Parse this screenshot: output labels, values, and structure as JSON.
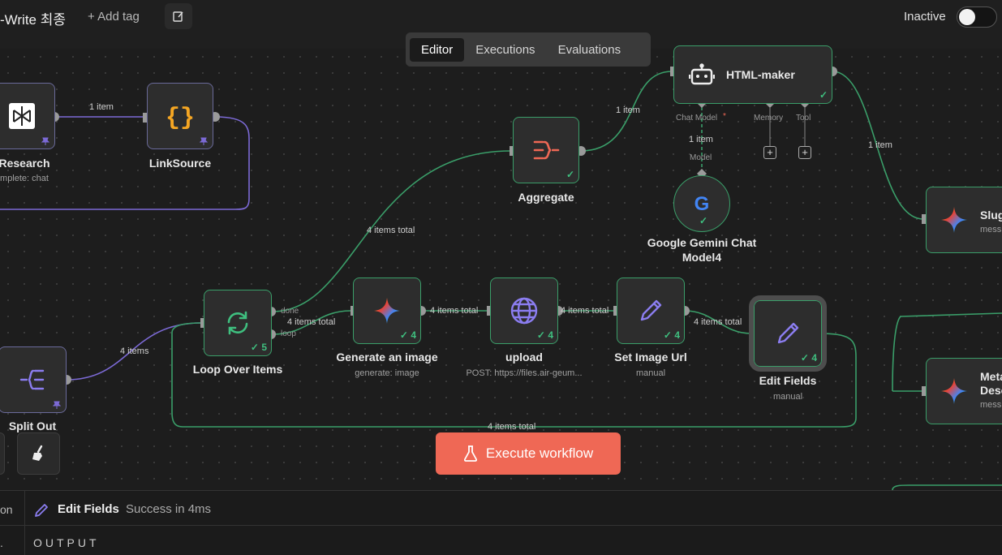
{
  "header": {
    "workflow_title": "-Write 최종",
    "add_tag": "+ Add tag",
    "status_label": "Inactive"
  },
  "tabs": [
    {
      "label": "Editor",
      "active": true
    },
    {
      "label": "Executions",
      "active": false
    },
    {
      "label": "Evaluations",
      "active": false
    }
  ],
  "nodes": {
    "research": {
      "label": "Research",
      "sub": "mplete: chat"
    },
    "linksource": {
      "label": "LinkSource"
    },
    "aggregate": {
      "label": "Aggregate"
    },
    "html_maker": {
      "label": "HTML-maker",
      "ports": [
        "Chat Model",
        "*",
        "Memory",
        "Tool"
      ]
    },
    "gemini": {
      "label_line1": "Google Gemini Chat",
      "label_line2": "Model4"
    },
    "slug": {
      "label": "Slug",
      "sub": "mess"
    },
    "meta": {
      "label_line1": "Meta",
      "label_line2": "Desc",
      "sub": "mess"
    },
    "loop": {
      "label": "Loop Over Items",
      "count": "5",
      "port_done": "done",
      "port_loop": "loop"
    },
    "generate": {
      "label": "Generate an image",
      "sub": "generate: image",
      "count": "4"
    },
    "upload": {
      "label": "upload",
      "sub": "POST: https://files.air-geum...",
      "count": "4"
    },
    "set_image": {
      "label": "Set Image Url",
      "sub": "manual",
      "count": "4"
    },
    "edit_fields": {
      "label": "Edit Fields",
      "sub": "manual",
      "count": "4"
    },
    "split_out": {
      "label": "Split Out"
    }
  },
  "wire_labels": {
    "research_link": "1 item",
    "agg_html": "1 item",
    "html_slug": "1 item",
    "gemini_html": "1 item",
    "gemini_port": "Model",
    "loop_agg": "4 items total",
    "loop_gen": "4 items total",
    "gen_upload": "4 items total",
    "upload_set": "4 items total",
    "set_edit": "4 items total",
    "split_loop": "4 items",
    "feedback": "4 items total"
  },
  "execute_button": "Execute workflow",
  "bottom_panel": {
    "cut_left_1": "on",
    "cut_left_2": ".",
    "node_name": "Edit Fields",
    "status": "Success in 4ms",
    "output_label": "OUTPUT"
  },
  "colors": {
    "success": "#3a9e69",
    "pinned": "#7c6ad6",
    "execute": "#ef6855"
  }
}
